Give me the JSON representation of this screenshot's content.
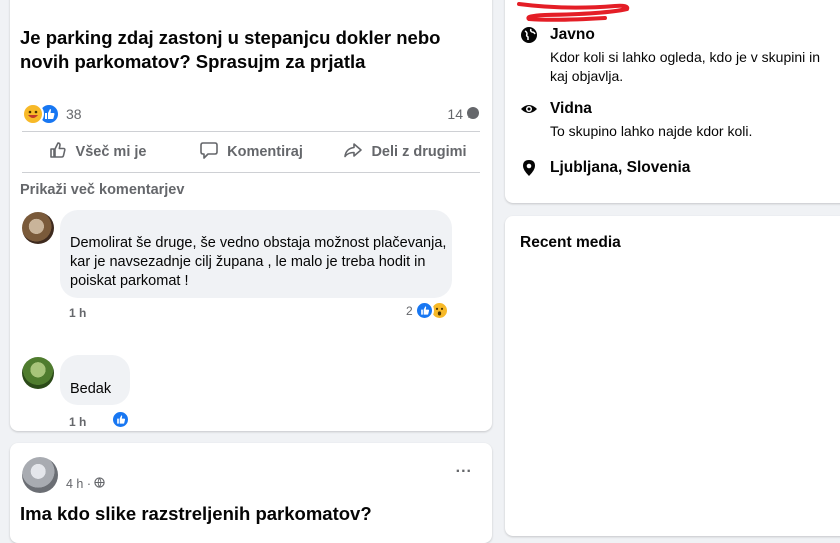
{
  "post1": {
    "title": "Je parking zdaj zastonj u stepanjcu dokler nebo novih parkomatov? Sprasujm za prjatla",
    "reactions_count": "38",
    "comments_count": "14",
    "actions": {
      "like": "Všeč mi je",
      "comment": "Komentiraj",
      "share": "Deli z drugimi"
    },
    "more_comments": "Prikaži več komentarjev",
    "comments": [
      {
        "text": "Demolirat še druge, še vedno obstaja možnost plačevanja, kar je navsezadnje cilj župana , le malo je treba hodit in poiskat parkomat !",
        "time": "1 h",
        "reaction_count": "2"
      },
      {
        "text": "Bedak",
        "time": "1 h"
      }
    ]
  },
  "post2": {
    "time": "4 h ·",
    "title": "Ima kdo slike razstreljenih parkomatov?",
    "more": "..."
  },
  "about": {
    "items": [
      {
        "icon": "globe-icon",
        "title": "Javno",
        "sub": "Kdor koli si lahko ogleda, kdo je v skupini in kaj objavlja."
      },
      {
        "icon": "eye-icon",
        "title": "Vidna",
        "sub": "To skupino lahko najde kdor koli."
      },
      {
        "icon": "location-pin-icon",
        "title": "Ljubljana, Slovenia"
      }
    ]
  },
  "media": {
    "title": "Recent media"
  },
  "colors": {
    "accent": "#1877f2",
    "annotation": "#e41e26"
  }
}
